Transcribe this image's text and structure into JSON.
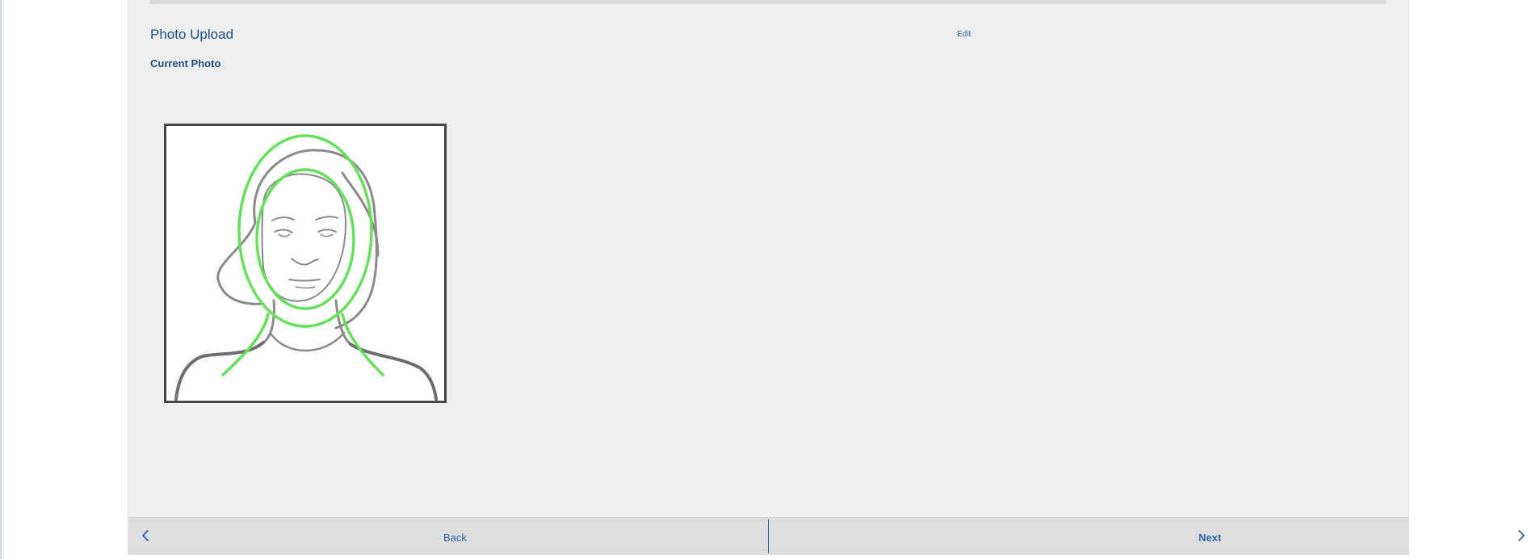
{
  "section": {
    "title": "Photo Upload",
    "edit_label": "Edit",
    "field_label": "Current Photo"
  },
  "photo": {
    "icon": "face-guide-illustration",
    "outline_color": "#8a8a8a",
    "guide_color": "#66e05a"
  },
  "nav": {
    "back_label": "Back",
    "next_label": "Next",
    "back_icon": "chevron-left-icon",
    "next_icon": "chevron-right-icon"
  },
  "colors": {
    "accent": "#2a64a8",
    "heading": "#1f4f7f",
    "panel": "#eeeeee",
    "footer": "#dddddd"
  }
}
